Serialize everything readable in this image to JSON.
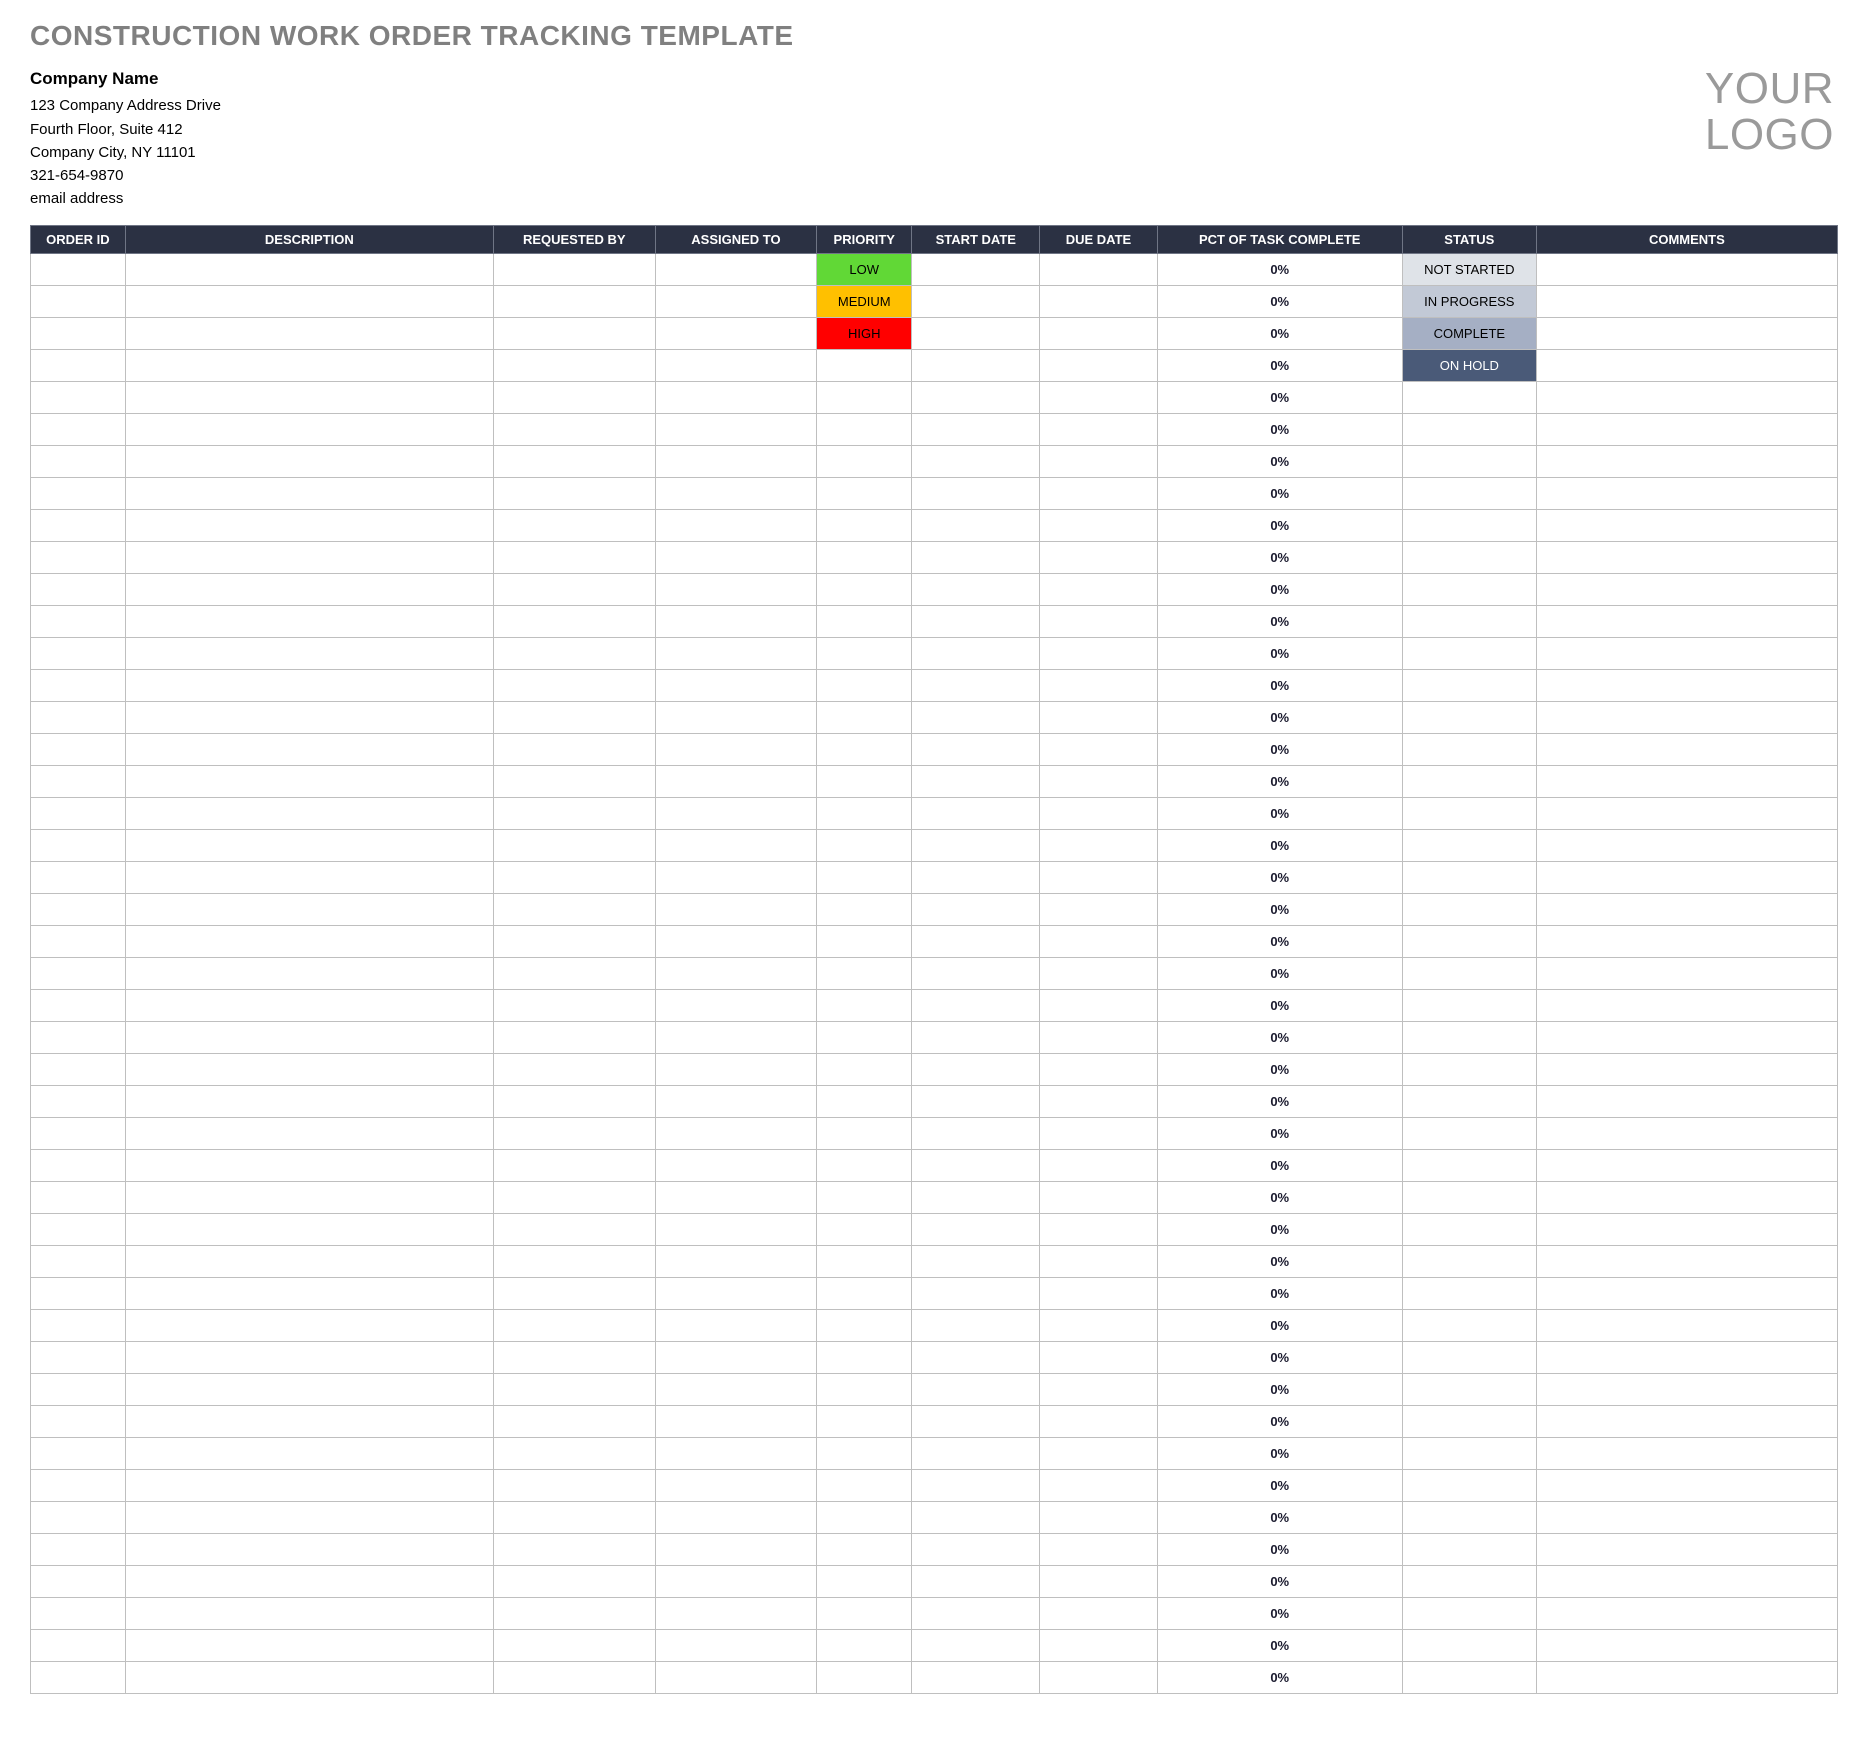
{
  "title": "CONSTRUCTION WORK ORDER TRACKING TEMPLATE",
  "company": {
    "name": "Company Name",
    "address1": "123 Company Address Drive",
    "address2": "Fourth Floor, Suite 412",
    "city_line": "Company City, NY  11101",
    "phone": "321-654-9870",
    "email": "email address"
  },
  "logo_line1": "YOUR",
  "logo_line2": "LOGO",
  "headers": {
    "order_id": "ORDER ID",
    "description": "DESCRIPTION",
    "requested_by": "REQUESTED BY",
    "assigned_to": "ASSIGNED TO",
    "priority": "PRIORITY",
    "start_date": "START DATE",
    "due_date": "DUE DATE",
    "pct_complete": "PCT OF TASK COMPLETE",
    "status": "STATUS",
    "comments": "COMMENTS"
  },
  "priority_options": {
    "low": "LOW",
    "medium": "MEDIUM",
    "high": "HIGH"
  },
  "status_options": {
    "not_started": "NOT STARTED",
    "in_progress": "IN PROGRESS",
    "complete": "COMPLETE",
    "on_hold": "ON HOLD"
  },
  "rows": [
    {
      "order_id": "",
      "description": "",
      "requested_by": "",
      "assigned_to": "",
      "priority": "LOW",
      "priority_class": "priority-low",
      "start_date": "",
      "due_date": "",
      "pct": "0%",
      "status": "NOT STARTED",
      "status_class": "status-notstarted",
      "comments": ""
    },
    {
      "order_id": "",
      "description": "",
      "requested_by": "",
      "assigned_to": "",
      "priority": "MEDIUM",
      "priority_class": "priority-medium",
      "start_date": "",
      "due_date": "",
      "pct": "0%",
      "status": "IN PROGRESS",
      "status_class": "status-inprogress",
      "comments": ""
    },
    {
      "order_id": "",
      "description": "",
      "requested_by": "",
      "assigned_to": "",
      "priority": "HIGH",
      "priority_class": "priority-high",
      "start_date": "",
      "due_date": "",
      "pct": "0%",
      "status": "COMPLETE",
      "status_class": "status-complete",
      "comments": ""
    },
    {
      "order_id": "",
      "description": "",
      "requested_by": "",
      "assigned_to": "",
      "priority": "",
      "priority_class": "",
      "start_date": "",
      "due_date": "",
      "pct": "0%",
      "status": "ON HOLD",
      "status_class": "status-onhold",
      "comments": ""
    },
    {
      "order_id": "",
      "description": "",
      "requested_by": "",
      "assigned_to": "",
      "priority": "",
      "priority_class": "",
      "start_date": "",
      "due_date": "",
      "pct": "0%",
      "status": "",
      "status_class": "",
      "comments": ""
    },
    {
      "order_id": "",
      "description": "",
      "requested_by": "",
      "assigned_to": "",
      "priority": "",
      "priority_class": "",
      "start_date": "",
      "due_date": "",
      "pct": "0%",
      "status": "",
      "status_class": "",
      "comments": ""
    },
    {
      "order_id": "",
      "description": "",
      "requested_by": "",
      "assigned_to": "",
      "priority": "",
      "priority_class": "",
      "start_date": "",
      "due_date": "",
      "pct": "0%",
      "status": "",
      "status_class": "",
      "comments": ""
    },
    {
      "order_id": "",
      "description": "",
      "requested_by": "",
      "assigned_to": "",
      "priority": "",
      "priority_class": "",
      "start_date": "",
      "due_date": "",
      "pct": "0%",
      "status": "",
      "status_class": "",
      "comments": ""
    },
    {
      "order_id": "",
      "description": "",
      "requested_by": "",
      "assigned_to": "",
      "priority": "",
      "priority_class": "",
      "start_date": "",
      "due_date": "",
      "pct": "0%",
      "status": "",
      "status_class": "",
      "comments": ""
    },
    {
      "order_id": "",
      "description": "",
      "requested_by": "",
      "assigned_to": "",
      "priority": "",
      "priority_class": "",
      "start_date": "",
      "due_date": "",
      "pct": "0%",
      "status": "",
      "status_class": "",
      "comments": ""
    },
    {
      "order_id": "",
      "description": "",
      "requested_by": "",
      "assigned_to": "",
      "priority": "",
      "priority_class": "",
      "start_date": "",
      "due_date": "",
      "pct": "0%",
      "status": "",
      "status_class": "",
      "comments": ""
    },
    {
      "order_id": "",
      "description": "",
      "requested_by": "",
      "assigned_to": "",
      "priority": "",
      "priority_class": "",
      "start_date": "",
      "due_date": "",
      "pct": "0%",
      "status": "",
      "status_class": "",
      "comments": ""
    },
    {
      "order_id": "",
      "description": "",
      "requested_by": "",
      "assigned_to": "",
      "priority": "",
      "priority_class": "",
      "start_date": "",
      "due_date": "",
      "pct": "0%",
      "status": "",
      "status_class": "",
      "comments": ""
    },
    {
      "order_id": "",
      "description": "",
      "requested_by": "",
      "assigned_to": "",
      "priority": "",
      "priority_class": "",
      "start_date": "",
      "due_date": "",
      "pct": "0%",
      "status": "",
      "status_class": "",
      "comments": ""
    },
    {
      "order_id": "",
      "description": "",
      "requested_by": "",
      "assigned_to": "",
      "priority": "",
      "priority_class": "",
      "start_date": "",
      "due_date": "",
      "pct": "0%",
      "status": "",
      "status_class": "",
      "comments": ""
    },
    {
      "order_id": "",
      "description": "",
      "requested_by": "",
      "assigned_to": "",
      "priority": "",
      "priority_class": "",
      "start_date": "",
      "due_date": "",
      "pct": "0%",
      "status": "",
      "status_class": "",
      "comments": ""
    },
    {
      "order_id": "",
      "description": "",
      "requested_by": "",
      "assigned_to": "",
      "priority": "",
      "priority_class": "",
      "start_date": "",
      "due_date": "",
      "pct": "0%",
      "status": "",
      "status_class": "",
      "comments": ""
    },
    {
      "order_id": "",
      "description": "",
      "requested_by": "",
      "assigned_to": "",
      "priority": "",
      "priority_class": "",
      "start_date": "",
      "due_date": "",
      "pct": "0%",
      "status": "",
      "status_class": "",
      "comments": ""
    },
    {
      "order_id": "",
      "description": "",
      "requested_by": "",
      "assigned_to": "",
      "priority": "",
      "priority_class": "",
      "start_date": "",
      "due_date": "",
      "pct": "0%",
      "status": "",
      "status_class": "",
      "comments": ""
    },
    {
      "order_id": "",
      "description": "",
      "requested_by": "",
      "assigned_to": "",
      "priority": "",
      "priority_class": "",
      "start_date": "",
      "due_date": "",
      "pct": "0%",
      "status": "",
      "status_class": "",
      "comments": ""
    },
    {
      "order_id": "",
      "description": "",
      "requested_by": "",
      "assigned_to": "",
      "priority": "",
      "priority_class": "",
      "start_date": "",
      "due_date": "",
      "pct": "0%",
      "status": "",
      "status_class": "",
      "comments": ""
    },
    {
      "order_id": "",
      "description": "",
      "requested_by": "",
      "assigned_to": "",
      "priority": "",
      "priority_class": "",
      "start_date": "",
      "due_date": "",
      "pct": "0%",
      "status": "",
      "status_class": "",
      "comments": ""
    },
    {
      "order_id": "",
      "description": "",
      "requested_by": "",
      "assigned_to": "",
      "priority": "",
      "priority_class": "",
      "start_date": "",
      "due_date": "",
      "pct": "0%",
      "status": "",
      "status_class": "",
      "comments": ""
    },
    {
      "order_id": "",
      "description": "",
      "requested_by": "",
      "assigned_to": "",
      "priority": "",
      "priority_class": "",
      "start_date": "",
      "due_date": "",
      "pct": "0%",
      "status": "",
      "status_class": "",
      "comments": ""
    },
    {
      "order_id": "",
      "description": "",
      "requested_by": "",
      "assigned_to": "",
      "priority": "",
      "priority_class": "",
      "start_date": "",
      "due_date": "",
      "pct": "0%",
      "status": "",
      "status_class": "",
      "comments": ""
    },
    {
      "order_id": "",
      "description": "",
      "requested_by": "",
      "assigned_to": "",
      "priority": "",
      "priority_class": "",
      "start_date": "",
      "due_date": "",
      "pct": "0%",
      "status": "",
      "status_class": "",
      "comments": ""
    },
    {
      "order_id": "",
      "description": "",
      "requested_by": "",
      "assigned_to": "",
      "priority": "",
      "priority_class": "",
      "start_date": "",
      "due_date": "",
      "pct": "0%",
      "status": "",
      "status_class": "",
      "comments": ""
    },
    {
      "order_id": "",
      "description": "",
      "requested_by": "",
      "assigned_to": "",
      "priority": "",
      "priority_class": "",
      "start_date": "",
      "due_date": "",
      "pct": "0%",
      "status": "",
      "status_class": "",
      "comments": ""
    },
    {
      "order_id": "",
      "description": "",
      "requested_by": "",
      "assigned_to": "",
      "priority": "",
      "priority_class": "",
      "start_date": "",
      "due_date": "",
      "pct": "0%",
      "status": "",
      "status_class": "",
      "comments": ""
    },
    {
      "order_id": "",
      "description": "",
      "requested_by": "",
      "assigned_to": "",
      "priority": "",
      "priority_class": "",
      "start_date": "",
      "due_date": "",
      "pct": "0%",
      "status": "",
      "status_class": "",
      "comments": ""
    },
    {
      "order_id": "",
      "description": "",
      "requested_by": "",
      "assigned_to": "",
      "priority": "",
      "priority_class": "",
      "start_date": "",
      "due_date": "",
      "pct": "0%",
      "status": "",
      "status_class": "",
      "comments": ""
    },
    {
      "order_id": "",
      "description": "",
      "requested_by": "",
      "assigned_to": "",
      "priority": "",
      "priority_class": "",
      "start_date": "",
      "due_date": "",
      "pct": "0%",
      "status": "",
      "status_class": "",
      "comments": ""
    },
    {
      "order_id": "",
      "description": "",
      "requested_by": "",
      "assigned_to": "",
      "priority": "",
      "priority_class": "",
      "start_date": "",
      "due_date": "",
      "pct": "0%",
      "status": "",
      "status_class": "",
      "comments": ""
    },
    {
      "order_id": "",
      "description": "",
      "requested_by": "",
      "assigned_to": "",
      "priority": "",
      "priority_class": "",
      "start_date": "",
      "due_date": "",
      "pct": "0%",
      "status": "",
      "status_class": "",
      "comments": ""
    },
    {
      "order_id": "",
      "description": "",
      "requested_by": "",
      "assigned_to": "",
      "priority": "",
      "priority_class": "",
      "start_date": "",
      "due_date": "",
      "pct": "0%",
      "status": "",
      "status_class": "",
      "comments": ""
    },
    {
      "order_id": "",
      "description": "",
      "requested_by": "",
      "assigned_to": "",
      "priority": "",
      "priority_class": "",
      "start_date": "",
      "due_date": "",
      "pct": "0%",
      "status": "",
      "status_class": "",
      "comments": ""
    },
    {
      "order_id": "",
      "description": "",
      "requested_by": "",
      "assigned_to": "",
      "priority": "",
      "priority_class": "",
      "start_date": "",
      "due_date": "",
      "pct": "0%",
      "status": "",
      "status_class": "",
      "comments": ""
    },
    {
      "order_id": "",
      "description": "",
      "requested_by": "",
      "assigned_to": "",
      "priority": "",
      "priority_class": "",
      "start_date": "",
      "due_date": "",
      "pct": "0%",
      "status": "",
      "status_class": "",
      "comments": ""
    },
    {
      "order_id": "",
      "description": "",
      "requested_by": "",
      "assigned_to": "",
      "priority": "",
      "priority_class": "",
      "start_date": "",
      "due_date": "",
      "pct": "0%",
      "status": "",
      "status_class": "",
      "comments": ""
    },
    {
      "order_id": "",
      "description": "",
      "requested_by": "",
      "assigned_to": "",
      "priority": "",
      "priority_class": "",
      "start_date": "",
      "due_date": "",
      "pct": "0%",
      "status": "",
      "status_class": "",
      "comments": ""
    },
    {
      "order_id": "",
      "description": "",
      "requested_by": "",
      "assigned_to": "",
      "priority": "",
      "priority_class": "",
      "start_date": "",
      "due_date": "",
      "pct": "0%",
      "status": "",
      "status_class": "",
      "comments": ""
    },
    {
      "order_id": "",
      "description": "",
      "requested_by": "",
      "assigned_to": "",
      "priority": "",
      "priority_class": "",
      "start_date": "",
      "due_date": "",
      "pct": "0%",
      "status": "",
      "status_class": "",
      "comments": ""
    },
    {
      "order_id": "",
      "description": "",
      "requested_by": "",
      "assigned_to": "",
      "priority": "",
      "priority_class": "",
      "start_date": "",
      "due_date": "",
      "pct": "0%",
      "status": "",
      "status_class": "",
      "comments": ""
    },
    {
      "order_id": "",
      "description": "",
      "requested_by": "",
      "assigned_to": "",
      "priority": "",
      "priority_class": "",
      "start_date": "",
      "due_date": "",
      "pct": "0%",
      "status": "",
      "status_class": "",
      "comments": ""
    },
    {
      "order_id": "",
      "description": "",
      "requested_by": "",
      "assigned_to": "",
      "priority": "",
      "priority_class": "",
      "start_date": "",
      "due_date": "",
      "pct": "0%",
      "status": "",
      "status_class": "",
      "comments": ""
    }
  ]
}
